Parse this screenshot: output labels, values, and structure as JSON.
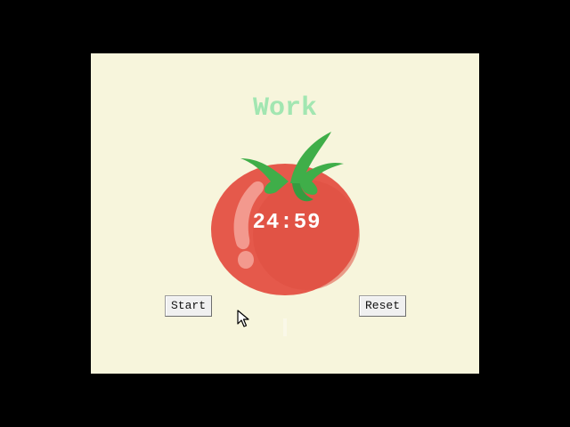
{
  "app": {
    "title": "Work",
    "timer": "24:59"
  },
  "controls": {
    "start_label": "Start",
    "reset_label": "Reset"
  },
  "colors": {
    "background": "#f7f5dc",
    "title": "#a2e6b1",
    "tomato": "#e5594b",
    "leaves": "#3fae49",
    "timer_text": "#ffffff"
  },
  "icons": {
    "tomato": "tomato-icon",
    "cursor": "mouse-pointer-icon"
  }
}
